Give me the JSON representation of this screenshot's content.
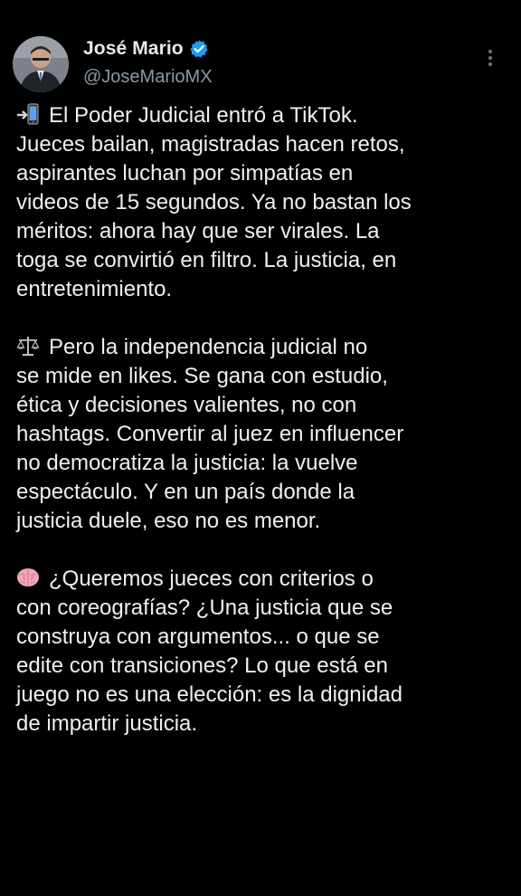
{
  "author": {
    "display_name": "José Mario",
    "handle": "@JoseMarioMX",
    "verified": true,
    "badge_color": "#1d9bf0"
  },
  "icons": {
    "verified": "verified-badge-icon",
    "more": "more-options-icon",
    "para1_emoji": "phone-arrow-icon",
    "para2_emoji": "scales-icon",
    "para3_emoji": "brain-icon"
  },
  "tweet": {
    "paragraphs": [
      {
        "text": "El Poder Judicial entró a TikTok.\nJueces bailan, magistradas hacen retos,\naspirantes luchan por simpatías en\nvideos de 15 segundos. Ya no bastan los\nméritos: ahora hay que ser virales. La\ntoga se convirtió en filtro. La justicia, en\nentretenimiento."
      },
      {
        "text": "Pero la independencia judicial no\nse mide en likes. Se gana con estudio,\nética y decisiones valientes, no con\nhashtags. Convertir al juez en influencer\nno democratiza la justicia: la vuelve\nespectáculo. Y en un país donde la\njusticia duele, eso no es menor."
      },
      {
        "text": "¿Queremos jueces con criterios o\ncon coreografías? ¿Una justicia que se\nconstruya con argumentos... o que se\nedite con transiciones? Lo que está en\njuego no es una elección: es la dignidad\nde impartir justicia."
      }
    ]
  },
  "colors": {
    "background": "#000000",
    "text": "#e7e9ea",
    "secondary_text": "#8b98a5"
  }
}
